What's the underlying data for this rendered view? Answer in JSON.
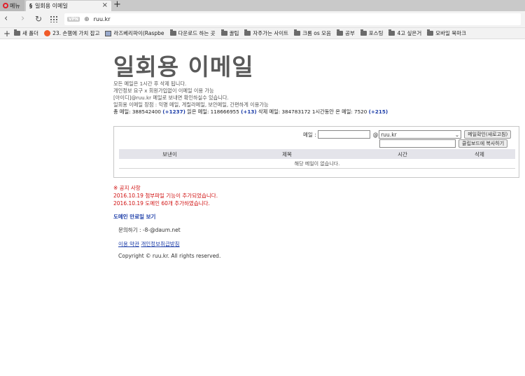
{
  "browser": {
    "menu_label": "메뉴",
    "tab_title": "일회용 이메일",
    "tab_favicon": "§",
    "new_tab": "+",
    "vpn_badge": "VPN",
    "url": "ruu.kr",
    "bookmarks": [
      {
        "icon": "folder",
        "label": "새 폴더"
      },
      {
        "icon": "red-circle",
        "label": "23. 손햄에 가치 잡고"
      },
      {
        "icon": "pc",
        "label": "라즈베리파이(Raspbe"
      },
      {
        "icon": "folder",
        "label": "다운로드 하는 곳"
      },
      {
        "icon": "folder",
        "label": "꿀팁"
      },
      {
        "icon": "folder",
        "label": "자주가는 사이트"
      },
      {
        "icon": "folder",
        "label": "크롬 os 모음"
      },
      {
        "icon": "folder",
        "label": "공부"
      },
      {
        "icon": "folder",
        "label": "포스팅"
      },
      {
        "icon": "folder",
        "label": "4고 싶은거"
      },
      {
        "icon": "folder",
        "label": "모바일 북마크"
      }
    ]
  },
  "page": {
    "title": "일회용 이메일",
    "intro": [
      "모든 메일은 1시간 후 삭제 됩니다.",
      "개인정보 요구 x 회원가입없이 이메일 이용 가능",
      "[아이디]@ruu.kr 메일로 보내면 확인하실수 있습니다.",
      "일회용 이메일 장점 : 익명 메일, 게릴라메일, 보안메일, 간편하게 이용가능"
    ],
    "stats": {
      "total_label": "총 메일: 388542400",
      "total_delta": "(+1237)",
      "read_label": " 읽은 메일: 118666955",
      "read_delta": "(+13)",
      "deleted_label": " 삭제 메일: 384783172 1시간동안 온 메일: 7520",
      "hour_delta": "(+215)"
    },
    "form": {
      "email_label": "메일 :",
      "at": "@",
      "domain_selected": "ruu.kr",
      "refresh_button": "메일확인(새로고침)",
      "copy_button": "클립보드에 복사하기"
    },
    "table": {
      "columns": [
        "보낸이",
        "제목",
        "시간",
        "삭제"
      ],
      "empty_message": "해당 메일이 없습니다."
    },
    "notice": {
      "title": "※ 공지 사항",
      "items": [
        "2016.10.19 첨부파일 기능이 추가되었습니다.",
        "2016.10.19 도메인 60개 추가하였습니다."
      ]
    },
    "domain_expiry_link": "도메인 만료일 보기",
    "contact": "문의하기 : -8-@daum.net",
    "terms_link": "이용 약관",
    "privacy_link": "개인정보취급방침",
    "copyright": "Copyright © ruu.kr. All rights reserved."
  },
  "colors": {
    "accent_link": "#1c3da8",
    "notice_red": "#d01010",
    "title_gray": "#5a5a5a"
  }
}
